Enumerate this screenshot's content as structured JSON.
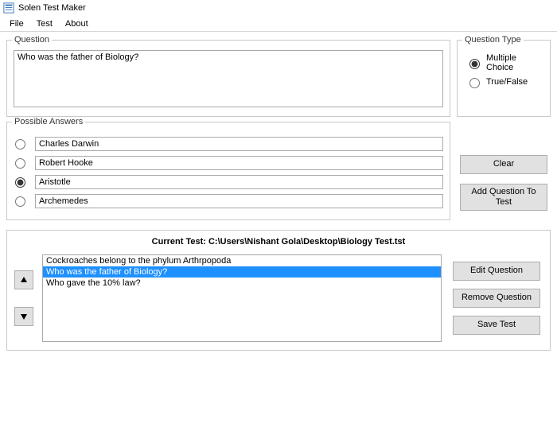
{
  "app": {
    "title": "Solen Test Maker"
  },
  "menu": {
    "file": "File",
    "test": "Test",
    "about": "About"
  },
  "question": {
    "legend": "Question",
    "text": "Who was the father of Biology?"
  },
  "questionType": {
    "legend": "Question Type",
    "multipleChoice": "Multiple Choice",
    "trueFalse": "True/False",
    "selected": "multipleChoice"
  },
  "answers": {
    "legend": "Possible Answers",
    "options": [
      "Charles Darwin",
      "Robert Hooke",
      "Aristotle",
      "Archemedes"
    ],
    "correctIndex": 2
  },
  "buttons": {
    "clear": "Clear",
    "addQuestion": "Add Question To Test",
    "editQuestion": "Edit Question",
    "removeQuestion": "Remove Question",
    "saveTest": "Save Test"
  },
  "currentTest": {
    "labelPrefix": "Current Test: ",
    "path": "C:\\Users\\Nishant Gola\\Desktop\\Biology Test.tst",
    "items": [
      "Cockroaches belong to the phylum Arthrpopoda",
      "Who was the father of Biology?",
      "Who gave the 10% law?"
    ],
    "selectedIndex": 1
  }
}
